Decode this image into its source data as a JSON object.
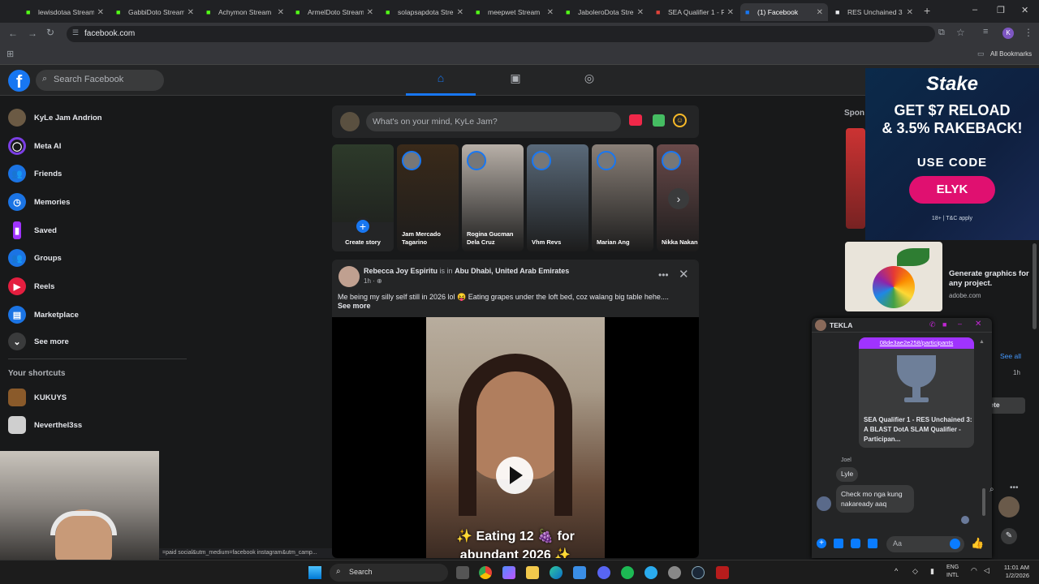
{
  "tabs": [
    {
      "label": "lewisdotaa Stream",
      "color": "#53fc18"
    },
    {
      "label": "GabbiDoto Stream",
      "color": "#53fc18"
    },
    {
      "label": "Achymon Stream",
      "color": "#53fc18"
    },
    {
      "label": "ArmelDoto Stream",
      "color": "#53fc18"
    },
    {
      "label": "solapsapdota Stre",
      "color": "#53fc18"
    },
    {
      "label": "meepwet Stream",
      "color": "#53fc18"
    },
    {
      "label": "JaboleroDota Stre",
      "color": "#53fc18"
    },
    {
      "label": "SEA Qualifier 1 - R",
      "color": "#e0433a"
    },
    {
      "label": "(1) Facebook",
      "color": "#1877f2"
    },
    {
      "label": "RES Unchained 3",
      "color": "#e8eaed"
    }
  ],
  "url": "facebook.com",
  "bookmarks_label": "All Bookmarks",
  "fb": {
    "search_placeholder": "Search Facebook",
    "user_name": "KyLe Jam Andrion",
    "menu": [
      {
        "label": "KyLe Jam Andrion",
        "icon": "avatar",
        "color": "#6b5a44"
      },
      {
        "label": "Meta AI",
        "icon": "meta-ai-icon",
        "color": "#7b3fe4"
      },
      {
        "label": "Friends",
        "icon": "friends-icon",
        "color": "#1b74e4"
      },
      {
        "label": "Memories",
        "icon": "memories-icon",
        "color": "#1b74e4"
      },
      {
        "label": "Saved",
        "icon": "saved-icon",
        "color": "#a033ff"
      },
      {
        "label": "Groups",
        "icon": "groups-icon",
        "color": "#1b74e4"
      },
      {
        "label": "Reels",
        "icon": "reels-icon",
        "color": "#e41e3f"
      },
      {
        "label": "Marketplace",
        "icon": "marketplace-icon",
        "color": "#1b74e4"
      }
    ],
    "see_more": "See more",
    "shortcuts_title": "Your shortcuts",
    "shortcuts": [
      {
        "label": "KUKUYS"
      },
      {
        "label": "Neverthel3ss"
      }
    ],
    "composer_placeholder": "What's on your mind, KyLe Jam?",
    "stories": [
      {
        "name": "Create story",
        "bg": "#2d3a2a"
      },
      {
        "name": "Jam Mercado Tagarino",
        "bg": "#3a2a1a"
      },
      {
        "name": "Rogina Gucman Dela Cruz",
        "bg": "#b8b0a8"
      },
      {
        "name": "Vhm Revs",
        "bg": "#5a6a7a"
      },
      {
        "name": "Marian Ang",
        "bg": "#8a8078"
      },
      {
        "name": "Nikka Nakan",
        "bg": "#6a4a4a"
      }
    ],
    "post": {
      "author": "Rebecca Joy Espiritu",
      "location_prefix": "is in",
      "location": "Abu Dhabi, United Arab Emirates",
      "time": "1h · ",
      "text": "Me being my silly self still in 2026 lol 😝 Eating grapes under the loft bed, coz walang big table hehe....",
      "see_more": "See more",
      "caption_line1": "✨ Eating 12 🍇 for",
      "caption_line2": "abundant 2026 ✨"
    },
    "sponsored_label": "Spon",
    "stake_ad": {
      "brand": "Stake",
      "line1": "GET $7 RELOAD",
      "line2": "& 3.5% RAKEBACK!",
      "use_code": "USE CODE",
      "code": "ELYK",
      "disclaimer": "18+ | T&C apply"
    },
    "adobe_ad": {
      "title": "Generate graphics for any project.",
      "domain": "adobe.com"
    },
    "see_all": "See all",
    "side_time": "1h",
    "side_delete": "lete"
  },
  "chat": {
    "title": "TEKLA",
    "link_text": "08de3ae2e258/participants",
    "card_title": "SEA Qualifier 1 - RES Unchained 3: A BLAST DotA SLAM Qualifier - Participan...",
    "sender": "Joel",
    "msg1": "Lyle",
    "msg2": "Check mo nga kung nakaready aaq",
    "input_placeholder": "Aa"
  },
  "status_url": "=paid social&utm_medium=facebook instagram&utm_camp...",
  "taskbar": {
    "search": "Search",
    "lang1": "ENG",
    "lang2": "INTL",
    "time": "11:01 AM",
    "date": "1/2/2026"
  }
}
